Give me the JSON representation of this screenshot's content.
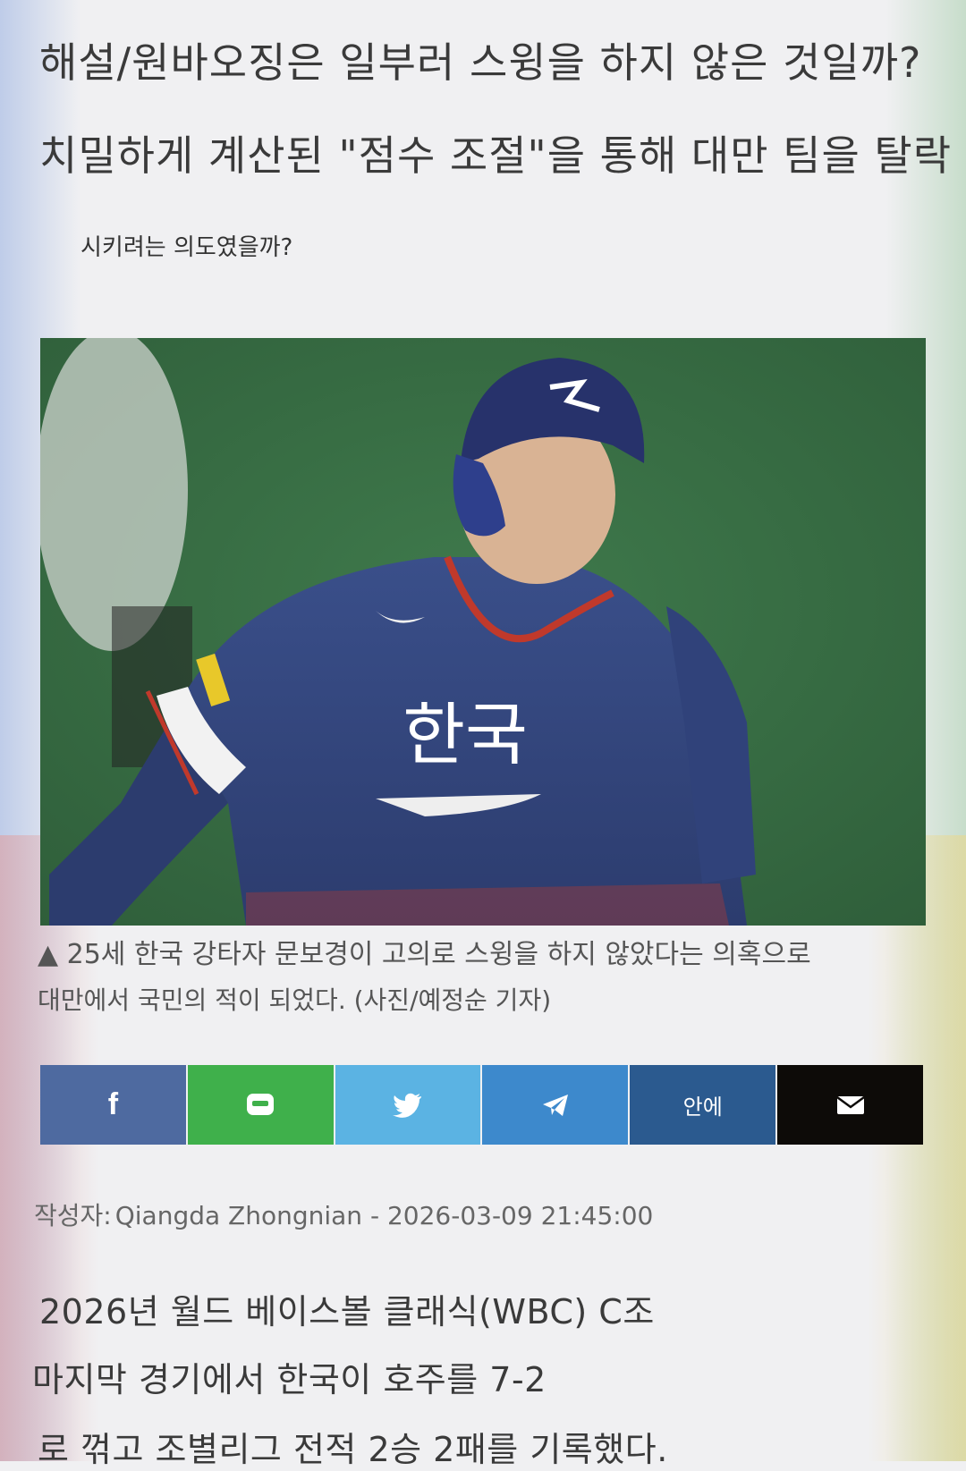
{
  "article": {
    "title_line1": "해설/원바오징은 일부러 스윙을 하지 않은 것일까?",
    "title_line2": "치밀하게 계산된 \"점수 조절\"을 통해 대만 팀을 탈락",
    "title_line3": "시키려는 의도였을까?",
    "photo": {
      "jersey_text": "한국"
    },
    "caption_line1": "▲ 25세 한국 강타자 문보경이 고의로 스윙을 하지 않았다는 의혹으로",
    "caption_line2": "대만에서 국민의 적이 되었다. (사진/예정순 기자)",
    "share": {
      "buttons": [
        {
          "name": "facebook",
          "label": "f",
          "color": "#4e6aa0",
          "icon": "facebook-icon"
        },
        {
          "name": "line",
          "label": "",
          "color": "#3fb04b",
          "icon": "line-icon"
        },
        {
          "name": "twitter",
          "label": "",
          "color": "#5bb3e3",
          "icon": "twitter-icon"
        },
        {
          "name": "telegram",
          "label": "",
          "color": "#3d89cc",
          "icon": "telegram-icon"
        },
        {
          "name": "other",
          "label": "안에",
          "color": "#2b5a8f",
          "icon": ""
        },
        {
          "name": "email",
          "label": "",
          "color": "#0d0b08",
          "icon": "envelope-icon"
        }
      ]
    },
    "meta": {
      "author_label": "작성자:",
      "author_and_date": "Qiangda Zhongnian - 2026-03-09 21:45:00"
    },
    "body": {
      "line1": "2026년 월드 베이스볼 클래식(WBC) C조",
      "line2": "마지막 경기에서 한국이 호주를 7-2",
      "line3": "로 꺾고 조별리그 전적 2승 2패를 기록했다."
    }
  }
}
